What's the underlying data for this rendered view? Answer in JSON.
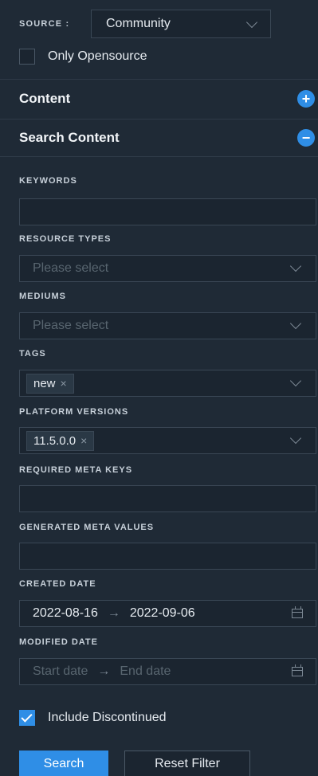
{
  "source": {
    "label": "SOURCE :",
    "value": "Community"
  },
  "only_opensource": {
    "label": "Only Opensource",
    "checked": false
  },
  "sections": {
    "content": {
      "title": "Content",
      "icon": "plus-icon"
    },
    "search_content": {
      "title": "Search Content",
      "icon": "minus-icon"
    }
  },
  "fields": {
    "keywords": {
      "label": "KEYWORDS",
      "value": ""
    },
    "resource_types": {
      "label": "RESOURCE TYPES",
      "placeholder": "Please select"
    },
    "mediums": {
      "label": "MEDIUMS",
      "placeholder": "Please select"
    },
    "tags": {
      "label": "TAGS",
      "selected": [
        "new"
      ]
    },
    "platform_versions": {
      "label": "PLATFORM VERSIONS",
      "selected": [
        "11.5.0.0"
      ]
    },
    "required_meta_keys": {
      "label": "REQUIRED META KEYS",
      "value": ""
    },
    "generated_meta_values": {
      "label": "GENERATED META VALUES",
      "value": ""
    },
    "created_date": {
      "label": "CREATED DATE",
      "start": "2022-08-16",
      "end": "2022-09-06"
    },
    "modified_date": {
      "label": "MODIFIED DATE",
      "start_placeholder": "Start date",
      "end_placeholder": "End date"
    }
  },
  "include_discontinued": {
    "label": "Include Discontinued",
    "checked": true
  },
  "buttons": {
    "search": "Search",
    "reset": "Reset Filter"
  },
  "glyphs": {
    "remove": "×",
    "arrow": "→"
  },
  "colors": {
    "background": "#1f2a36",
    "accent": "#2f8ee6"
  }
}
